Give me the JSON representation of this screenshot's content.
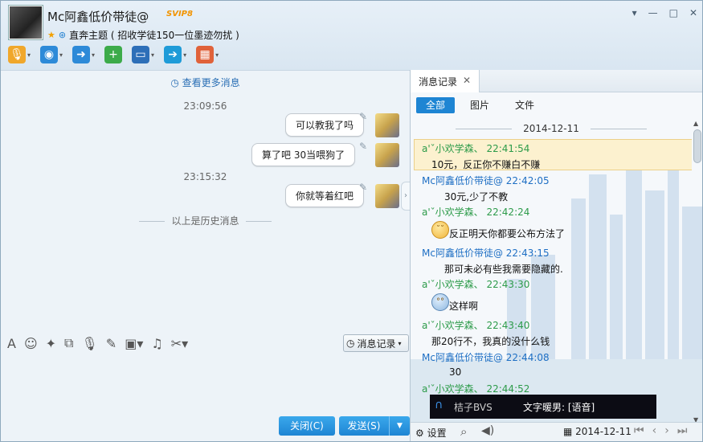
{
  "header": {
    "nickname": "Mc阿鑫低价带徒@",
    "vip_badge": "SVIP8",
    "signature": "直奔主题 ( 招收学徒150一位墨迹勿扰 )",
    "window_buttons": [
      "▾",
      "—",
      "□",
      "✕"
    ]
  },
  "toolbar": {
    "items": [
      {
        "name": "voice-call-icon",
        "glyph": "🎙",
        "color": "#f0a72b"
      },
      {
        "name": "video-call-icon",
        "glyph": "◉",
        "color": "#2d8ad8"
      },
      {
        "name": "send-file-icon",
        "glyph": "➜",
        "color": "#2d8ad8"
      },
      {
        "name": "add-app-icon",
        "glyph": "+",
        "color": "#3cab4a"
      },
      {
        "name": "remote-desktop-icon",
        "glyph": "▭",
        "color": "#2d6fb8"
      },
      {
        "name": "share-screen-icon",
        "glyph": "➔",
        "color": "#1e9bd8"
      },
      {
        "name": "apps-grid-icon",
        "glyph": "▦",
        "color": "#e0623a"
      }
    ]
  },
  "chat": {
    "more_messages": "查看更多消息",
    "time1": "23:09:56",
    "msg1": "可以教我了吗",
    "msg2": "算了吧    30当喂狗了",
    "time2": "23:15:32",
    "msg3": "你就等着红吧",
    "history_divider": "以上是历史消息"
  },
  "format_bar": {
    "history_button": "消息记录"
  },
  "actions": {
    "close": "关闭(C)",
    "send": "发送(S)"
  },
  "record_panel": {
    "tab_title": "消息记录",
    "filters": [
      "全部",
      "图片",
      "文件"
    ],
    "date": "2014-12-11",
    "entries": [
      {
        "sender": "a'ˇ小欢学森、",
        "time": "22:41:54",
        "text": "10元，反正你不赚白不赚",
        "who": "g"
      },
      {
        "sender": "Mc阿鑫低价带徒@",
        "time": "22:42:05",
        "text": "30元,少了不教",
        "who": "b"
      },
      {
        "sender": "a'ˇ小欢学森、",
        "time": "22:42:24",
        "text": "反正明天你都要公布方法了",
        "who": "g"
      },
      {
        "sender": "Mc阿鑫低价带徒@",
        "time": "22:43:15",
        "text": "那可未必有些我需要隐藏的.",
        "who": "b"
      },
      {
        "sender": "a'ˇ小欢学森、",
        "time": "22:43:30",
        "text": "这样啊",
        "who": "g"
      },
      {
        "sender": "a'ˇ小欢学森、",
        "time": "22:43:40",
        "text": "那20行不，我真的没什么钱",
        "who": "g"
      },
      {
        "sender": "Mc阿鑫低价带徒@",
        "time": "22:44:08",
        "text": "30",
        "who": "b"
      },
      {
        "sender": "a'ˇ小欢学森、",
        "time": "22:44:52",
        "text": "",
        "who": "g"
      }
    ],
    "voice_left": "桔子BVS",
    "voice_right": "文字暖男: [语音]"
  },
  "record_footer": {
    "settings": "设置",
    "date": "2014-12-11"
  }
}
